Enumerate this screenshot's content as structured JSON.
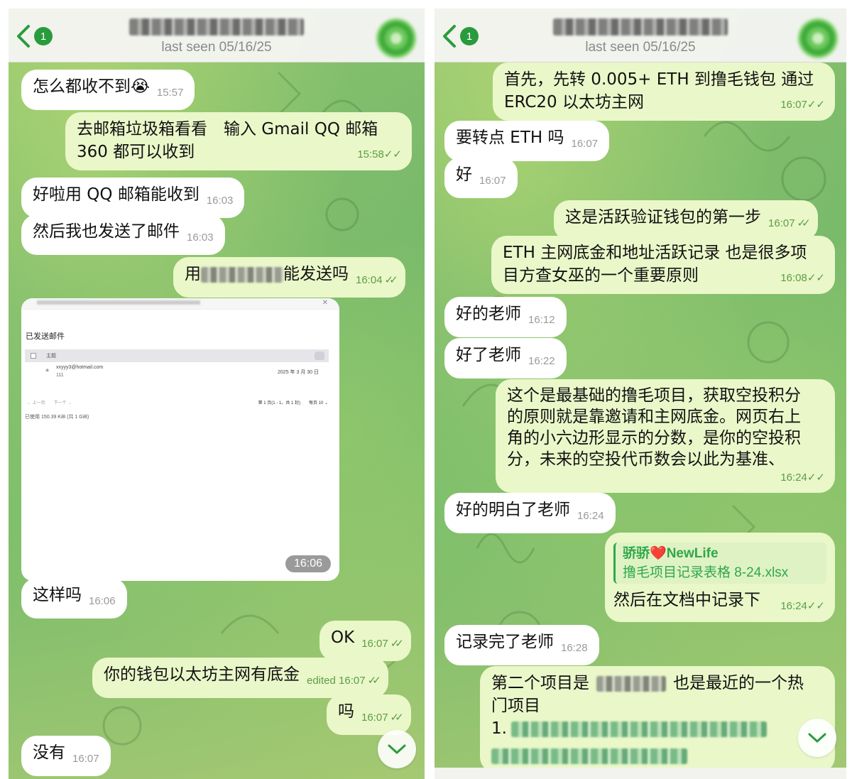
{
  "left": {
    "header": {
      "badge": "1",
      "status": "last seen 05/16/25"
    },
    "messages": [
      {
        "text": "怎么都收不到",
        "emoji": "😭",
        "time": "15:57"
      },
      {
        "line1": "去邮箱垃圾箱看看　输入 Gmail  QQ 邮箱",
        "line2": "360 都可以收到",
        "time": "15:58"
      },
      {
        "text": "好啦用 QQ 邮箱能收到",
        "time": "16:03"
      },
      {
        "text": "然后我也发送了邮件",
        "time": "16:03"
      },
      {
        "prefix": "用",
        "suffix": "能发送吗",
        "time": "16:04"
      },
      {
        "text": "这样吗",
        "time": "16:06"
      },
      {
        "text": "OK",
        "time": "16:07"
      },
      {
        "text": "你的钱包以太坊主网有底金",
        "time": "edited 16:07"
      },
      {
        "text": "吗",
        "time": "16:07"
      },
      {
        "text": "没有",
        "time": "16:07"
      }
    ],
    "screenshot": {
      "sent_title": "已发送邮件",
      "toolbar_label": "主题",
      "from": "xxyyy3@hotmail.com",
      "subject": "111",
      "date": "2025 年 3 月 30 日",
      "pager_left": "← 上一页　　下一个 →",
      "pager_right": "第 1 页(1 - 1，共 1 封)　　每页 10 ⌄",
      "usage": "已使用 150.39 KiB (共 1 GiB)",
      "time": "16:06"
    }
  },
  "right": {
    "header": {
      "badge": "1",
      "status": "last seen 05/16/25"
    },
    "messages": [
      {
        "line1": "首先，先转 0.005+ ETH 到撸毛钱包  通过",
        "line2": "ERC20 以太坊主网",
        "time": "16:07"
      },
      {
        "text": "要转点 ETH 吗",
        "time": "16:07"
      },
      {
        "text": "好",
        "time": "16:07"
      },
      {
        "text": "这是活跃验证钱包的第一步",
        "time": "16:07"
      },
      {
        "line1": "ETH 主网底金和地址活跃记录 也是很多项",
        "line2": "目方查女巫的一个重要原则",
        "time": "16:08"
      },
      {
        "text": "好的老师",
        "time": "16:12"
      },
      {
        "text": "好了老师",
        "time": "16:22"
      },
      {
        "line1": "这个是最基础的撸毛项目，获取空投积分",
        "line2": "的原则就是靠邀请和主网底金。网页右上",
        "line3": "角的小六边形显示的分数，是你的空投积",
        "line4": "分，未来的空投代币数会以此为基准、",
        "time": "16:24"
      },
      {
        "text": "好的明白了老师",
        "time": "16:24"
      },
      {
        "sender_a": "骄骄",
        "sender_heart": "❤️",
        "sender_b": "NewLife",
        "file": "撸毛项目记录表格 8-24.xlsx",
        "text": "然后在文档中记录下",
        "time": "16:24"
      },
      {
        "text": "记录完了老师",
        "time": "16:28"
      },
      {
        "line1a": "第二个项目是",
        "line1b": "也是最近的一个热",
        "line2": "门项目",
        "line3": "1."
      }
    ]
  },
  "colors": {
    "incoming": "#ffffff",
    "outgoing": "#eaf7c9",
    "accent": "#2a9b3c",
    "time_out": "#5a9e45"
  },
  "icons": [
    "chevron-left-icon",
    "double-check-icon",
    "chevron-down-icon",
    "heart-icon"
  ]
}
